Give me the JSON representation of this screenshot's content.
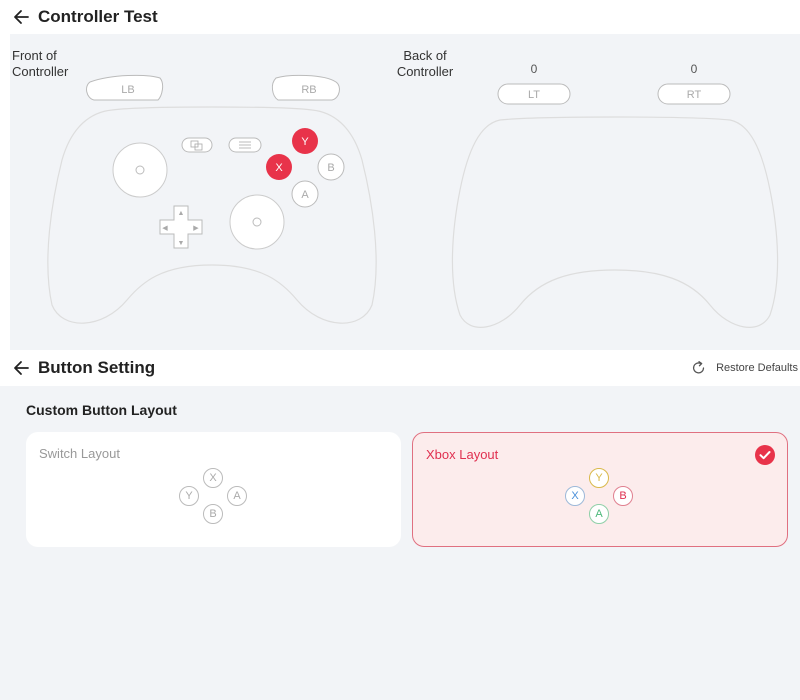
{
  "controller_test": {
    "title": "Controller Test",
    "front_label": "Front of\nController",
    "back_label": "Back of\nController",
    "buttons": {
      "lb": "LB",
      "rb": "RB",
      "lt": "LT",
      "rt": "RT",
      "y": "Y",
      "x": "X",
      "b": "B",
      "a": "A"
    },
    "lt_value": "0",
    "rt_value": "0",
    "active_color": "#e8334a"
  },
  "button_setting": {
    "title": "Button Setting",
    "restore_label": "Restore Defaults",
    "section_title": "Custom Button Layout",
    "layouts": [
      {
        "label": "Switch Layout",
        "selected": false,
        "buttons": {
          "top": "X",
          "left": "Y",
          "right": "A",
          "bottom": "B"
        }
      },
      {
        "label": "Xbox Layout",
        "selected": true,
        "buttons": {
          "top": "Y",
          "left": "X",
          "right": "B",
          "bottom": "A"
        }
      }
    ],
    "xbox_colors": {
      "y": "#d9b94a",
      "x": "#4a8fd9",
      "b": "#e03050",
      "a": "#4cb87a"
    },
    "accent_color": "#e8334a"
  }
}
